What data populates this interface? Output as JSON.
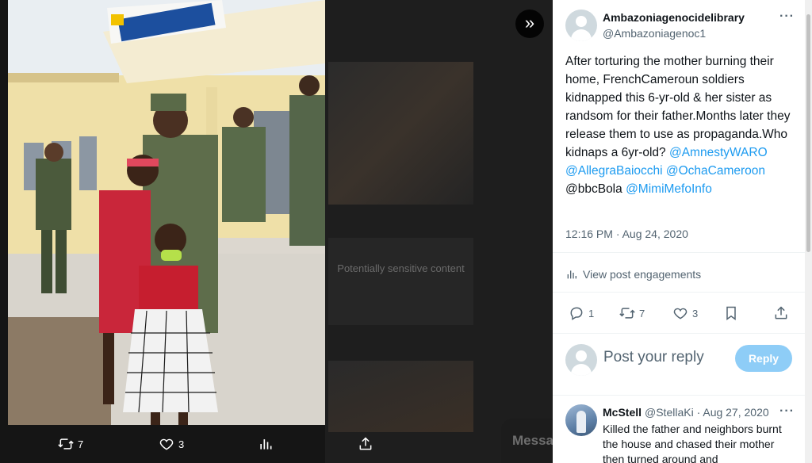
{
  "viewer": {
    "expand_icon": "double-chevron-right-icon",
    "background_sensitive_text": "Potentially sensitive content",
    "background_messages_label": "Messages",
    "actions": {
      "retweets": "7",
      "likes": "3"
    }
  },
  "tweet": {
    "author_name": "Ambazoniagenocidelibrary",
    "author_handle": "@Ambazoniagenoc1",
    "text_plain": "After torturing the mother burning their home, FrenchCameroun soldiers kidnapped this 6-yr-old & her sister as randsom for their father.Months later they release them to use as propaganda.Who kidnaps a 6yr-old? ",
    "mentions": [
      "@AmnestyWARO",
      "@AllegraBaiocchi",
      "@OchaCameroon",
      "@bbcBola",
      "@MimiMefoInfo"
    ],
    "timestamp": "12:16 PM · Aug 24, 2020",
    "view_engagements": "View post engagements",
    "counts": {
      "replies": "1",
      "retweets": "7",
      "likes": "3"
    }
  },
  "reply_box": {
    "placeholder": "Post your reply",
    "button": "Reply"
  },
  "reply": {
    "name": "McStell",
    "handle_date": "@StellaKi · Aug 27, 2020",
    "text": "Killed the father and neighbors burnt the house and chased their mother then turned around and"
  },
  "colors": {
    "accent": "#1d9bf0",
    "reply_button": "#8ecdf7",
    "secondary_text": "#536471"
  }
}
